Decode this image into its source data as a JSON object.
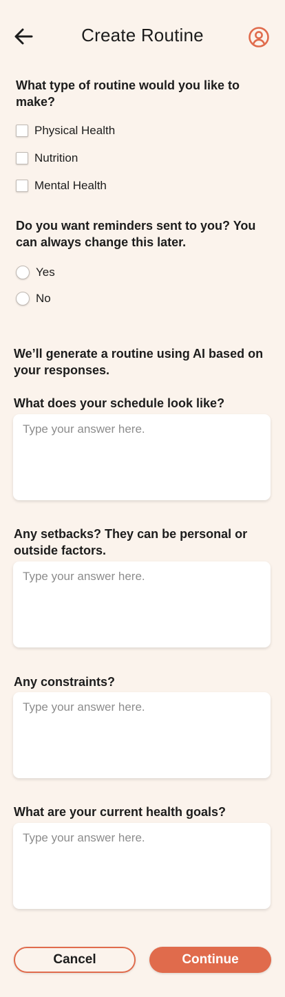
{
  "header": {
    "title": "Create Routine",
    "back_icon": "arrow-left-icon",
    "profile_icon": "user-circle-icon",
    "accent_color": "#e06b4c"
  },
  "routine_type": {
    "question": "What type of routine would you like to make?",
    "options": [
      "Physical Health",
      "Nutrition",
      "Mental Health"
    ]
  },
  "reminders": {
    "question": "Do you want reminders sent to you? You can always change this later.",
    "options": [
      "Yes",
      "No"
    ]
  },
  "ai_note": "We’ll generate a routine using AI based on your responses.",
  "questions": [
    {
      "label": "What does your schedule look like?",
      "placeholder": "Type your answer here.",
      "value": ""
    },
    {
      "label": "Any setbacks? They can be personal or outside factors.",
      "placeholder": "Type your answer here.",
      "value": ""
    },
    {
      "label": "Any constraints?",
      "placeholder": "Type your answer here.",
      "value": ""
    },
    {
      "label": "What are your current health goals?",
      "placeholder": "Type your answer here.",
      "value": ""
    }
  ],
  "actions": {
    "cancel": "Cancel",
    "continue": "Continue"
  }
}
